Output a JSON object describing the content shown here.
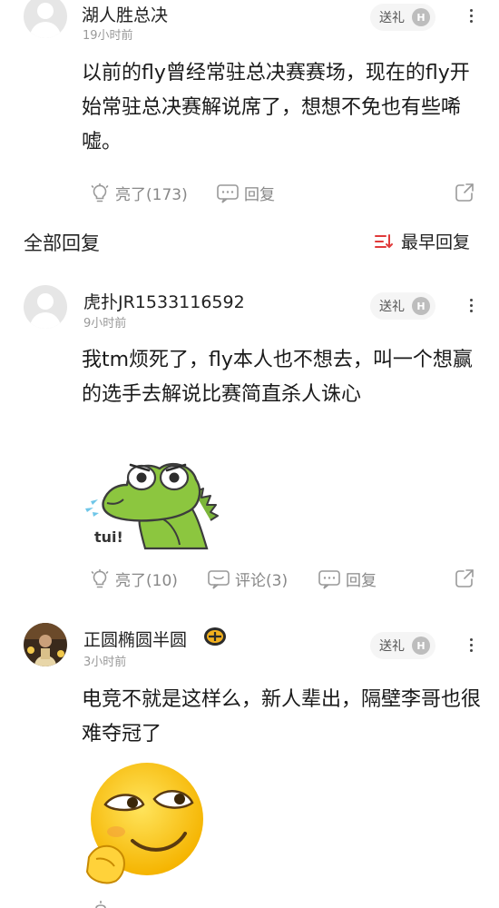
{
  "top_comment": {
    "username": "湖人胜总决",
    "time": "19小时前",
    "gift_label": "送礼",
    "badge": "H",
    "content": "以前的fly曾经常驻总决赛赛场，现在的fly开始常驻总决赛解说席了，想想不免也有些唏嘘。",
    "like_label": "亮了(173)",
    "reply_label": "回复"
  },
  "replies_header": {
    "title": "全部回复",
    "sort_label": "最早回复"
  },
  "replies": [
    {
      "username": "虎扑JR1533116592",
      "time": "9小时前",
      "gift_label": "送礼",
      "badge": "H",
      "content": "我tm烦死了，fly本人也不想去，叫一个想赢的选手去解说比赛简直杀人诛心",
      "sticker_text": "tui!",
      "like_label": "亮了(10)",
      "comment_label": "评论(3)",
      "reply_label": "回复"
    },
    {
      "username": "正圆椭圆半圆",
      "time": "3小时前",
      "gift_label": "送礼",
      "badge": "H",
      "content": "电竞不就是这样么，新人辈出，隔壁李哥也很难夺冠了"
    }
  ]
}
